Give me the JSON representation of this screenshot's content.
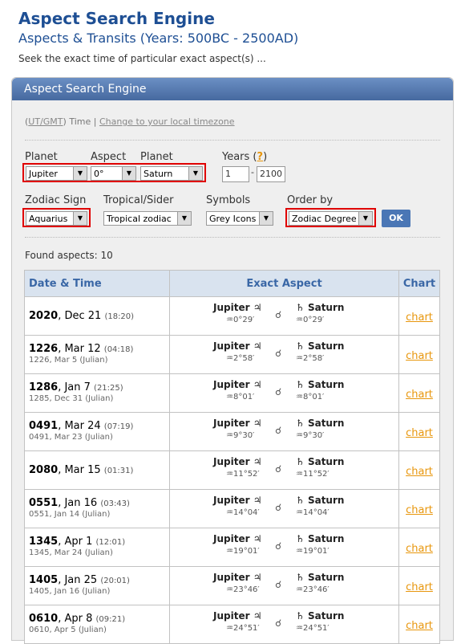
{
  "header": {
    "title": "Aspect Search Engine",
    "subtitle": "Aspects & Transits (Years: 500BC - 2500AD)",
    "description": "Seek the exact time of particular exact aspect(s) ..."
  },
  "panel": {
    "title": "Aspect Search Engine",
    "tz_ut": "UT/GMT",
    "tz_time": "Time |",
    "tz_link": "Change to your local timezone"
  },
  "form": {
    "planet_label": "Planet",
    "aspect_label": "Aspect",
    "planet2_label": "Planet",
    "years_label": "Years (",
    "years_help": "?",
    "years_close": ")",
    "planet1": "Jupiter",
    "aspect": "0°",
    "planet2": "Saturn",
    "year_from": "1",
    "year_sep": "-",
    "year_to": "2100",
    "zodiac_label": "Zodiac Sign",
    "trop_label": "Tropical/Sider",
    "symbols_label": "Symbols",
    "order_label": "Order by",
    "zodiac": "Aquarius",
    "tropical": "Tropical zodiac",
    "symbols": "Grey Icons",
    "order": "Zodiac Degree",
    "ok": "OK"
  },
  "results": {
    "found": "Found aspects: 10",
    "headers": [
      "Date & Time",
      "Exact Aspect",
      "Chart"
    ],
    "rows": [
      {
        "year": "2020",
        "date": ", Dec 21",
        "time": "(18:20)",
        "julian": "",
        "deg": "0°29′"
      },
      {
        "year": "1226",
        "date": ", Mar 12",
        "time": "(04:18)",
        "julian": "1226, Mar 5 (Julian)",
        "deg": "2°58′"
      },
      {
        "year": "1286",
        "date": ", Jan 7",
        "time": "(21:25)",
        "julian": "1285, Dec 31 (Julian)",
        "deg": "8°01′"
      },
      {
        "year": "0491",
        "date": ", Mar 24",
        "time": "(07:19)",
        "julian": "0491, Mar 23 (Julian)",
        "deg": "9°30′"
      },
      {
        "year": "2080",
        "date": ", Mar 15",
        "time": "(01:31)",
        "julian": "",
        "deg": "11°52′"
      },
      {
        "year": "0551",
        "date": ", Jan 16",
        "time": "(03:43)",
        "julian": "0551, Jan 14 (Julian)",
        "deg": "14°04′"
      },
      {
        "year": "1345",
        "date": ", Apr 1",
        "time": "(12:01)",
        "julian": "1345, Mar 24 (Julian)",
        "deg": "19°01′"
      },
      {
        "year": "1405",
        "date": ", Jan 25",
        "time": "(20:01)",
        "julian": "1405, Jan 16 (Julian)",
        "deg": "23°46′"
      },
      {
        "year": "0610",
        "date": ", Apr 8",
        "time": "(09:21)",
        "julian": "0610, Apr 5 (Julian)",
        "deg": "24°51′"
      }
    ],
    "planet1": "Jupiter",
    "planet2": "Saturn",
    "jupiter_symbol": "♃",
    "saturn_symbol": "♄",
    "aquarius_symbol": "♒",
    "conjunction_symbol": "☌",
    "chart_link": "chart"
  },
  "colors": {
    "title": "#1e4f94",
    "panel_header": "#46699f",
    "highlight": "#e00000",
    "link": "#e8960c"
  }
}
